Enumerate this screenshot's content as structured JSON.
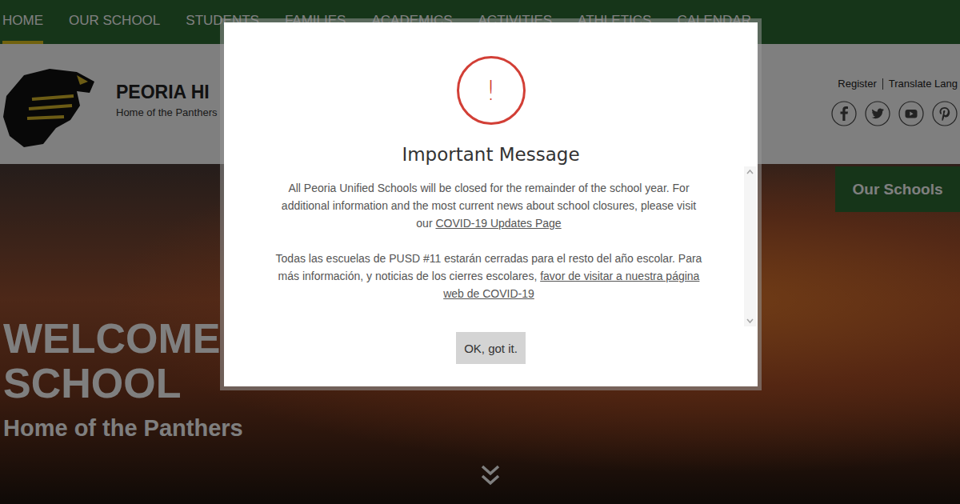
{
  "nav": [
    {
      "label": "HOME",
      "selected": true
    },
    {
      "label": "OUR SCHOOL",
      "selected": false
    },
    {
      "label": "STUDENTS",
      "selected": false
    },
    {
      "label": "FAMILIES",
      "selected": false
    },
    {
      "label": "ACADEMICS",
      "selected": false
    },
    {
      "label": "ACTIVITIES",
      "selected": false
    },
    {
      "label": "ATHLETICS",
      "selected": false
    },
    {
      "label": "CALENDAR",
      "selected": false
    }
  ],
  "header": {
    "school_name": "PEORIA HI",
    "tagline": "Home of the Panthers",
    "links": [
      "Register",
      "Translate Lang"
    ]
  },
  "our_schools_button": "Our Schools",
  "hero": {
    "title_lines": [
      "WELCOME T",
      "SCHOOL"
    ],
    "subtitle": "Home of the Panthers"
  },
  "modal": {
    "icon": "!",
    "title": "Important Message",
    "paragraphs": [
      [
        {
          "text": "All Peoria Unified Schools will be closed for the remainder of the school year. For additional information and the most current news about school closures, please visit our ",
          "link": false
        },
        {
          "text": "COVID-19 Updates Page",
          "link": true
        }
      ],
      [
        {
          "text": "Todas las escuelas de PUSD #11 estarán cerradas para el resto del año escolar. Para más información, y noticias de los cierres escolares, ",
          "link": false
        },
        {
          "text": "favor de visitar a nuestra página web de COVID-19",
          "link": true
        }
      ]
    ],
    "button": "OK, got it."
  }
}
